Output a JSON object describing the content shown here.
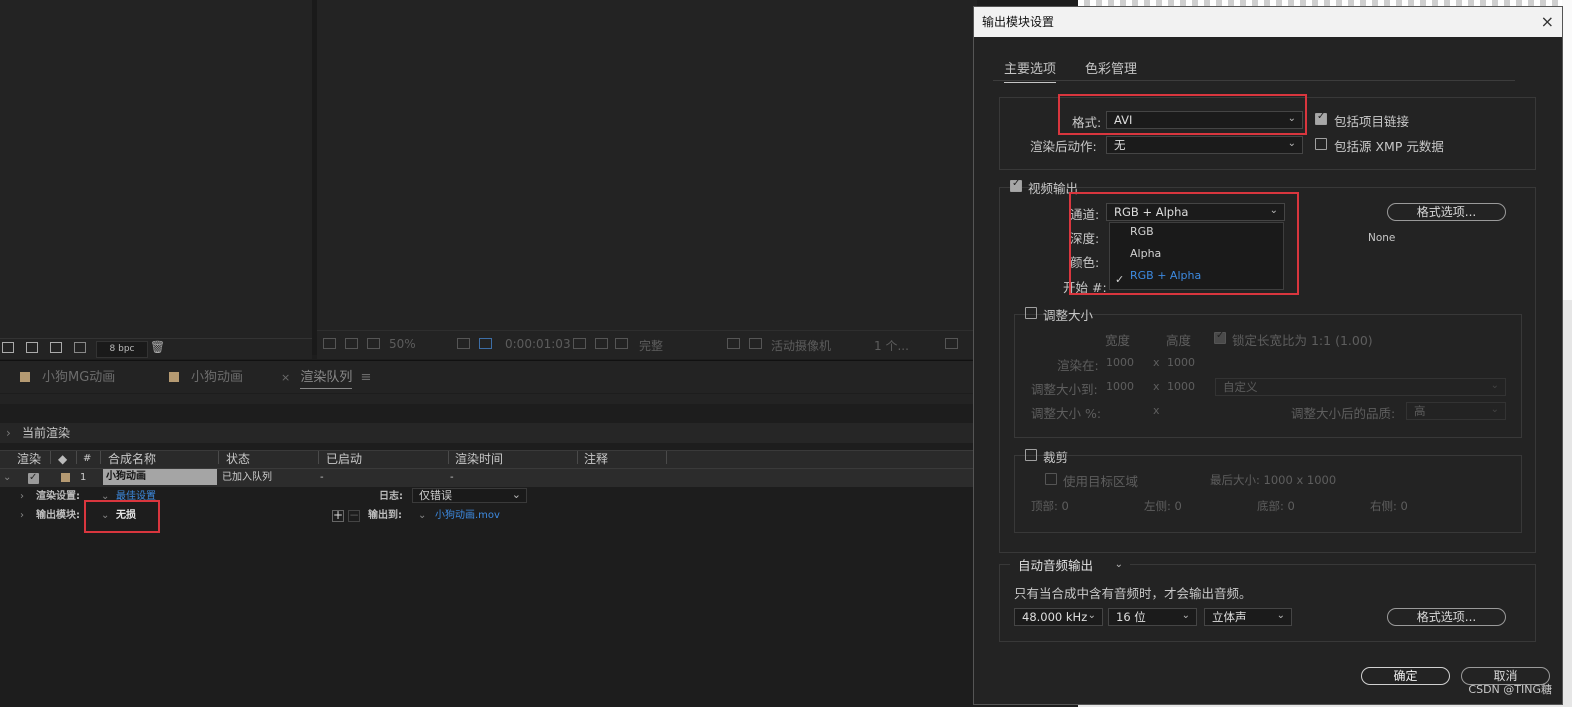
{
  "project_toolbar": {
    "bpc": "8 bpc"
  },
  "viewer_toolbar": {
    "zoom": "50%",
    "timecode": "0:00:01:03",
    "quality": "完整",
    "camera": "活动摄像机",
    "views": "1 个..."
  },
  "tabs": [
    {
      "label": "小狗MG动画"
    },
    {
      "label": "小狗动画"
    },
    {
      "label": "渲染队列",
      "close": "×",
      "menu": "≡"
    }
  ],
  "render_queue": {
    "current_render": "当前渲染",
    "columns": {
      "render": "渲染",
      "num": "#",
      "comp_name": "合成名称",
      "status": "状态",
      "started": "已启动",
      "render_time": "渲染时间",
      "comment": "注释"
    },
    "row": {
      "index": "1",
      "comp_name": "小狗动画",
      "status": "已加入队列",
      "started": "-",
      "render_time": "-"
    },
    "render_settings_label": "渲染设置:",
    "render_settings_value": "最佳设置",
    "log_label": "日志:",
    "log_value": "仅错误",
    "output_module_label": "输出模块:",
    "output_module_value": "无损",
    "output_to_label": "输出到:",
    "output_to_value": "小狗动画.mov"
  },
  "dialog": {
    "title": "输出模块设置",
    "close": "×",
    "tabs": {
      "main": "主要选项",
      "color": "色彩管理"
    },
    "format_label": "格式:",
    "format_value": "AVI",
    "include_project_link": "包括项目链接",
    "post_render_label": "渲染后动作:",
    "post_render_value": "无",
    "include_xmp": "包括源 XMP 元数据",
    "video_output": "视频输出",
    "channels_label": "通道:",
    "channels_value": "RGB + Alpha",
    "depth_label": "深度:",
    "color_label": "颜色:",
    "start_label": "开始 #:",
    "channel_options": [
      "RGB",
      "Alpha",
      "RGB + Alpha"
    ],
    "format_options_btn": "格式选项...",
    "codec_none": "None",
    "resize": "调整大小",
    "width": "宽度",
    "height": "高度",
    "lock_aspect": "锁定长宽比为 1:1 (1.00)",
    "render_at": "渲染在:",
    "render_at_w": "1000",
    "render_at_h": "1000",
    "resize_to": "调整大小到:",
    "resize_to_w": "1000",
    "resize_to_h": "1000",
    "custom": "自定义",
    "resize_pct": "调整大小 %:",
    "x": "x",
    "resize_quality": "调整大小后的品质:",
    "quality_value": "高",
    "crop": "裁剪",
    "use_roi": "使用目标区域",
    "final_size": "最后大小: 1000 x 1000",
    "top": "顶部: 0",
    "left": "左侧: 0",
    "bottom": "底部: 0",
    "right": "右侧: 0",
    "audio_auto": "自动音频输出",
    "audio_note": "只有当合成中含有音频时，才会输出音频。",
    "sample_rate": "48.000 kHz",
    "bit_depth": "16 位",
    "stereo": "立体声",
    "audio_format_btn": "格式选项...",
    "ok": "确定",
    "cancel": "取消"
  },
  "watermark": "CSDN @TING糖"
}
